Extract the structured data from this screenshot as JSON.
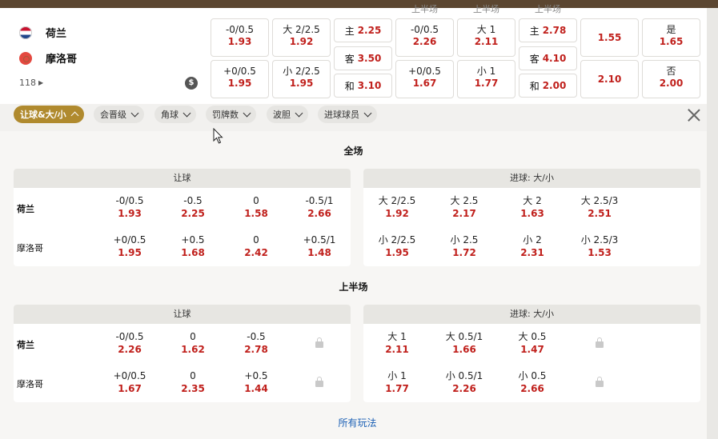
{
  "teams": {
    "home": "荷兰",
    "away": "摩洛哥"
  },
  "more_count": "118",
  "currency_icon": "$",
  "cut_labels": [
    "上半场",
    "上半场",
    "上半场"
  ],
  "header_markets": [
    {
      "top": {
        "line": "-0/0.5",
        "odds": "1.93"
      },
      "bottom": {
        "line": "+0/0.5",
        "odds": "1.95"
      }
    },
    {
      "top": {
        "line": "大 2/2.5",
        "odds": "1.92"
      },
      "bottom": {
        "line": "小 2/2.5",
        "odds": "1.95"
      }
    },
    {
      "inline": [
        {
          "label": "主",
          "odds": "2.25"
        },
        {
          "label": "客",
          "odds": "3.50"
        },
        {
          "label": "和",
          "odds": "3.10"
        }
      ]
    },
    {
      "top": {
        "line": "-0/0.5",
        "odds": "2.26"
      },
      "bottom": {
        "line": "+0/0.5",
        "odds": "1.67"
      }
    },
    {
      "top": {
        "line": "大 1",
        "odds": "2.11"
      },
      "bottom": {
        "line": "小 1",
        "odds": "1.77"
      }
    },
    {
      "inline": [
        {
          "label": "主",
          "odds": "2.78"
        },
        {
          "label": "客",
          "odds": "4.10"
        },
        {
          "label": "和",
          "odds": "2.00"
        }
      ]
    },
    {
      "top": {
        "odds": "1.55"
      },
      "bottom": {
        "odds": "2.10"
      }
    },
    {
      "top": {
        "line": "是",
        "odds": "1.65"
      },
      "bottom": {
        "line": "否",
        "odds": "2.00"
      }
    }
  ],
  "filters": [
    "让球&大/小",
    "会晋级",
    "角球",
    "罚牌数",
    "波胆",
    "进球球员"
  ],
  "sections": [
    {
      "title": "全场",
      "handicap": {
        "title": "让球",
        "home": [
          {
            "line": "-0/0.5",
            "odds": "1.93"
          },
          {
            "line": "-0.5",
            "odds": "2.25"
          },
          {
            "line": "0",
            "odds": "1.58"
          },
          {
            "line": "-0.5/1",
            "odds": "2.66"
          }
        ],
        "away": [
          {
            "line": "+0/0.5",
            "odds": "1.95"
          },
          {
            "line": "+0.5",
            "odds": "1.68"
          },
          {
            "line": "0",
            "odds": "2.42"
          },
          {
            "line": "+0.5/1",
            "odds": "1.48"
          }
        ]
      },
      "totals": {
        "title": "进球: 大/小",
        "over": [
          {
            "line": "大 2/2.5",
            "odds": "1.92"
          },
          {
            "line": "大 2.5",
            "odds": "2.17"
          },
          {
            "line": "大 2",
            "odds": "1.63"
          },
          {
            "line": "大 2.5/3",
            "odds": "2.51"
          }
        ],
        "under": [
          {
            "line": "小 2/2.5",
            "odds": "1.95"
          },
          {
            "line": "小 2.5",
            "odds": "1.72"
          },
          {
            "line": "小 2",
            "odds": "2.31"
          },
          {
            "line": "小 2.5/3",
            "odds": "1.53"
          }
        ]
      }
    },
    {
      "title": "上半场",
      "handicap": {
        "title": "让球",
        "home": [
          {
            "line": "-0/0.5",
            "odds": "2.26"
          },
          {
            "line": "0",
            "odds": "1.62"
          },
          {
            "line": "-0.5",
            "odds": "2.78"
          }
        ],
        "away": [
          {
            "line": "+0/0.5",
            "odds": "1.67"
          },
          {
            "line": "0",
            "odds": "2.35"
          },
          {
            "line": "+0.5",
            "odds": "1.44"
          }
        ]
      },
      "totals": {
        "title": "进球: 大/小",
        "over": [
          {
            "line": "大 1",
            "odds": "2.11"
          },
          {
            "line": "大 0.5/1",
            "odds": "1.66"
          },
          {
            "line": "大 0.5",
            "odds": "1.47"
          }
        ],
        "under": [
          {
            "line": "小 1",
            "odds": "1.77"
          },
          {
            "line": "小 0.5/1",
            "odds": "2.26"
          },
          {
            "line": "小 0.5",
            "odds": "2.66"
          }
        ]
      }
    }
  ],
  "all_markets_link": "所有玩法"
}
